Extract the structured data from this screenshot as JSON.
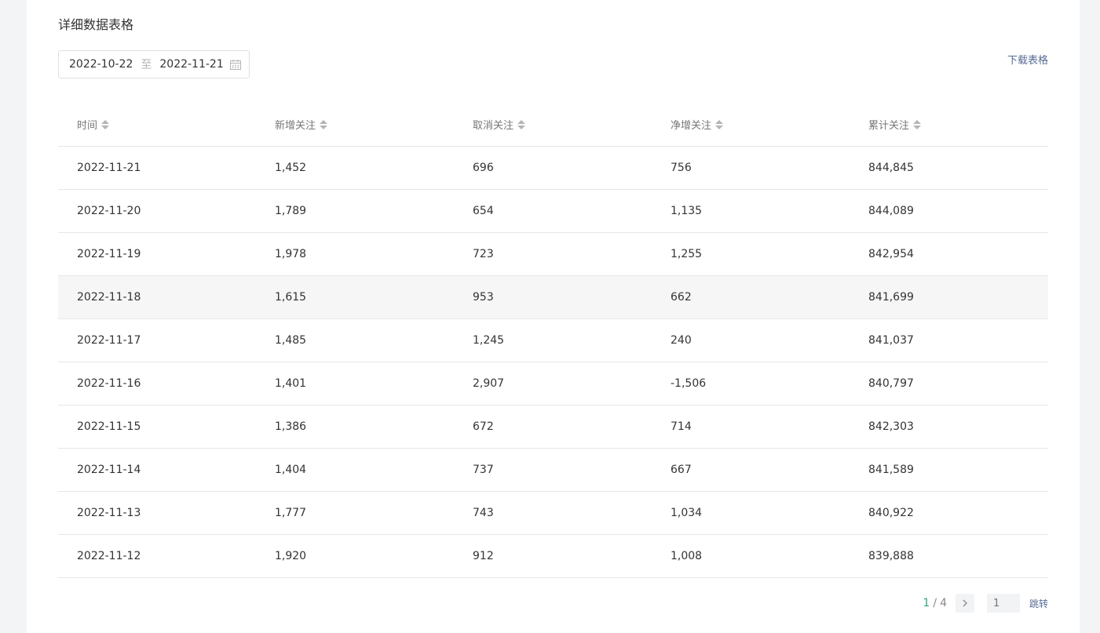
{
  "section": {
    "title": "详细数据表格",
    "download_label": "下载表格"
  },
  "date_range": {
    "start": "2022-10-22",
    "separator": "至",
    "end": "2022-11-21"
  },
  "table": {
    "headers": [
      "时间",
      "新增关注",
      "取消关注",
      "净增关注",
      "累计关注"
    ],
    "rows": [
      [
        "2022-11-21",
        "1,452",
        "696",
        "756",
        "844,845"
      ],
      [
        "2022-11-20",
        "1,789",
        "654",
        "1,135",
        "844,089"
      ],
      [
        "2022-11-19",
        "1,978",
        "723",
        "1,255",
        "842,954"
      ],
      [
        "2022-11-18",
        "1,615",
        "953",
        "662",
        "841,699"
      ],
      [
        "2022-11-17",
        "1,485",
        "1,245",
        "240",
        "841,037"
      ],
      [
        "2022-11-16",
        "1,401",
        "2,907",
        "-1,506",
        "840,797"
      ],
      [
        "2022-11-15",
        "1,386",
        "672",
        "714",
        "842,303"
      ],
      [
        "2022-11-14",
        "1,404",
        "737",
        "667",
        "841,589"
      ],
      [
        "2022-11-13",
        "1,777",
        "743",
        "1,034",
        "840,922"
      ],
      [
        "2022-11-12",
        "1,920",
        "912",
        "1,008",
        "839,888"
      ]
    ]
  },
  "pagination": {
    "current": "1",
    "separator": "/",
    "total": "4",
    "input_placeholder": "1",
    "jump_label": "跳转"
  },
  "colors": {
    "accent_green": "#2fa877",
    "link_blue": "#576b95"
  }
}
